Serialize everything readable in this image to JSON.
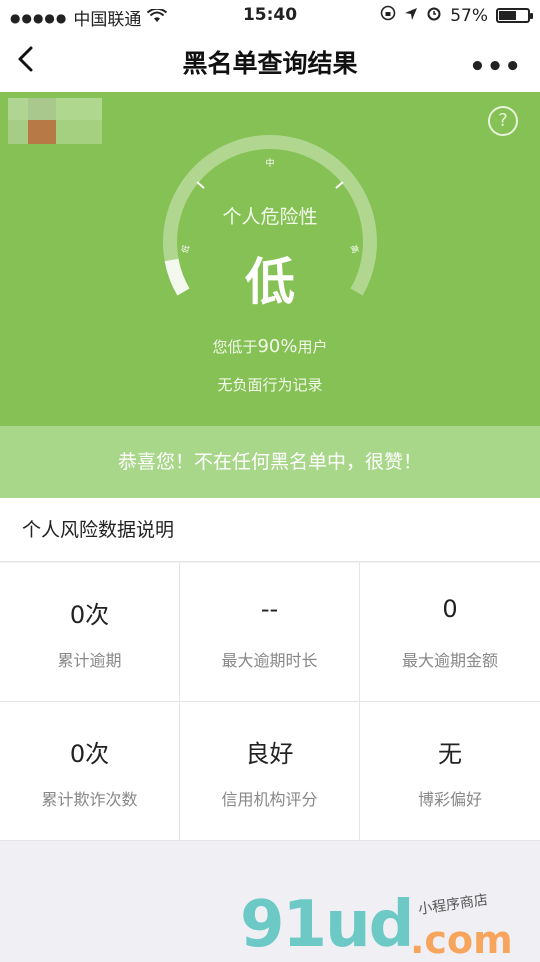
{
  "status_bar": {
    "carrier": "中国联通",
    "time": "15:40",
    "battery": "57%"
  },
  "nav": {
    "title": "黑名单查询结果",
    "more": "•••"
  },
  "hero": {
    "help": "?",
    "gauge_ticks": {
      "low": "低",
      "mid": "中",
      "high": "高"
    },
    "risk_label": "个人危险性",
    "risk_value": "低",
    "percent_prefix": "您低于",
    "percent_value": "90%",
    "percent_suffix": "用户",
    "record_text": "无负面行为记录"
  },
  "banner": {
    "text": "恭喜您！不在任何黑名单中，很赞！"
  },
  "section": {
    "title": "个人风险数据说明"
  },
  "stats": [
    {
      "value": "0次",
      "label": "累计逾期"
    },
    {
      "value": "--",
      "label": "最大逾期时长"
    },
    {
      "value": "0",
      "label": "最大逾期金额"
    },
    {
      "value": "0次",
      "label": "累计欺诈次数"
    },
    {
      "value": "良好",
      "label": "信用机构评分"
    },
    {
      "value": "无",
      "label": "博彩偏好"
    }
  ],
  "watermark": {
    "brand": "91ud",
    "domain": ".com",
    "tagline": "小程序商店"
  },
  "colors": {
    "hero_green": "#86c155",
    "banner_green": "#a8d78a"
  }
}
